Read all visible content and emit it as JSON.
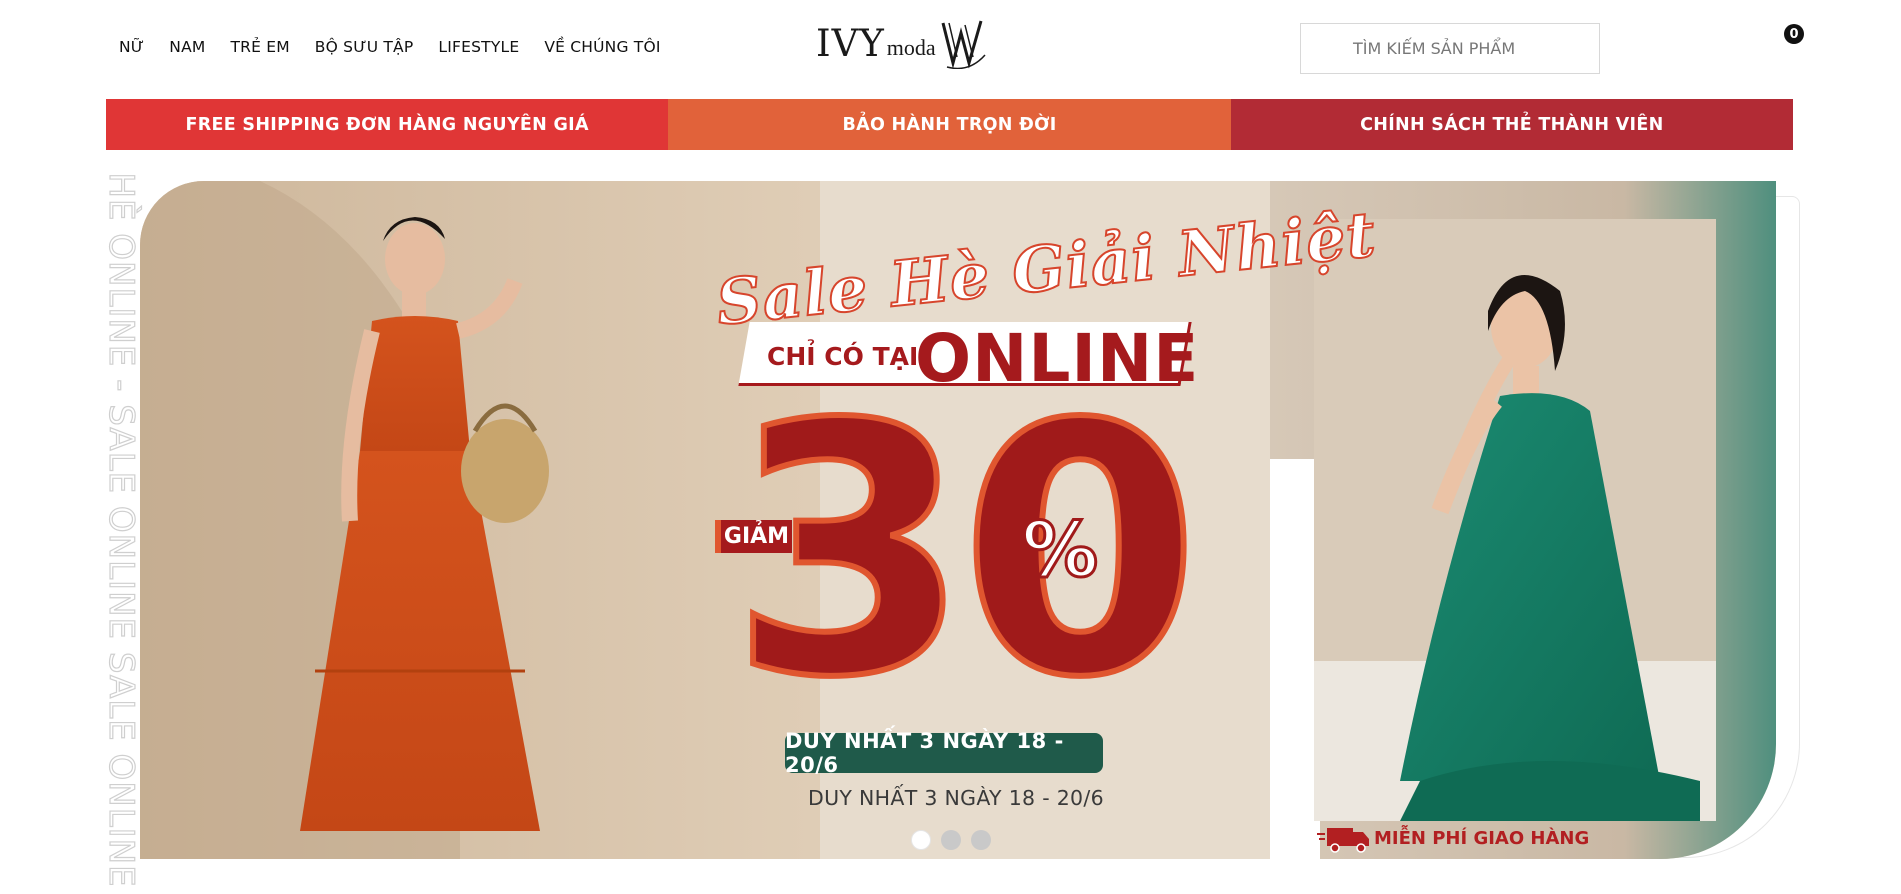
{
  "nav": {
    "items": [
      "NỮ",
      "NAM",
      "TRẺ EM",
      "BỘ SƯU TẬP",
      "LIFESTYLE",
      "VỀ CHÚNG TÔI"
    ]
  },
  "logo": {
    "brand": "IVY",
    "suffix": "moda"
  },
  "search": {
    "placeholder": "TÌM KIẾM SẢN PHẨM"
  },
  "cart": {
    "count": "0"
  },
  "promo": {
    "items": [
      "FREE SHIPPING ĐƠN HÀNG NGUYÊN GIÁ",
      "BẢO HÀNH TRỌN ĐỜI",
      "CHÍNH SÁCH THẺ THÀNH VIÊN"
    ]
  },
  "banner": {
    "side_text": "HÈ ONLINE - SALE ONLINE SALE ONLINE",
    "script_title": "Sale Hè Giải Nhiệt",
    "only_at": "CHỈ CÓ TẠI",
    "online": "ONLINE",
    "discount_label": "GIẢM",
    "discount_value": "30",
    "percent": "%",
    "date_pill": "DUY NHẤT 3 NGÀY 18 - 20/6",
    "date_sub": "DUY NHẤT 3 NGÀY 18 - 20/6",
    "free_delivery": "MIỄN PHÍ GIAO HÀNG",
    "slides": 3,
    "active_slide": 1
  },
  "colors": {
    "promo_left": "#e03636",
    "promo_mid": "#e1623a",
    "promo_right": "#b22b35",
    "sale_red": "#a01a1a",
    "pill_green": "#1f5a4a"
  }
}
